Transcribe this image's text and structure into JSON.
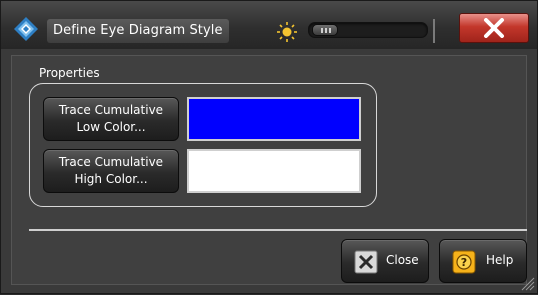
{
  "window": {
    "title": "Define Eye Diagram Style",
    "icons": {
      "app": "rohde-schwarz-diamond-icon",
      "brightness": "sun-icon",
      "close": "close-x-icon"
    }
  },
  "properties": {
    "group_label": "Properties",
    "low_color": {
      "label_line1": "Trace Cumulative",
      "label_line2": "Low Color...",
      "swatch_color": "#0000ff"
    },
    "high_color": {
      "label_line1": "Trace Cumulative",
      "label_line2": "High Color...",
      "swatch_color": "#ffffff"
    }
  },
  "footer": {
    "close_label": "Close",
    "help_label": "Help"
  }
}
